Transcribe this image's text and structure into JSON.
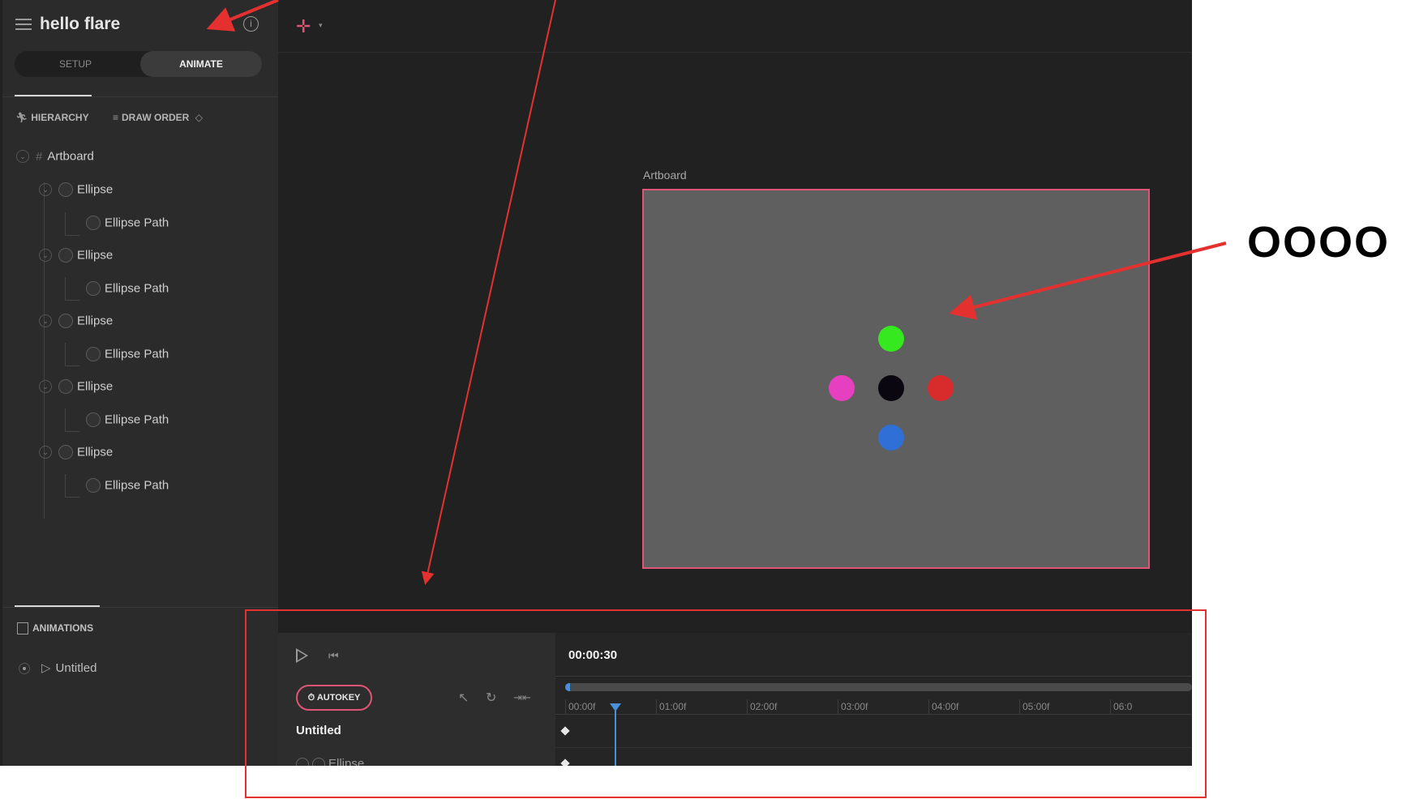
{
  "sidebar": {
    "title": "hello flare",
    "info_icon": "info-icon",
    "modes": {
      "setup": "SETUP",
      "animate": "ANIMATE",
      "active": "ANIMATE"
    },
    "tabs": {
      "hierarchy": "HIERARCHY",
      "draw_order": "DRAW ORDER"
    },
    "tree": [
      {
        "label": "Artboard",
        "type": "artboard"
      },
      {
        "label": "Ellipse",
        "type": "shape"
      },
      {
        "label": "Ellipse Path",
        "type": "path"
      },
      {
        "label": "Ellipse",
        "type": "shape"
      },
      {
        "label": "Ellipse Path",
        "type": "path"
      },
      {
        "label": "Ellipse",
        "type": "shape"
      },
      {
        "label": "Ellipse Path",
        "type": "path"
      },
      {
        "label": "Ellipse",
        "type": "shape"
      },
      {
        "label": "Ellipse Path",
        "type": "path"
      },
      {
        "label": "Ellipse",
        "type": "shape"
      },
      {
        "label": "Ellipse Path",
        "type": "path"
      }
    ],
    "animations": {
      "title": "ANIMATIONS",
      "items": [
        {
          "label": "Untitled"
        }
      ]
    }
  },
  "stage": {
    "artboard_label": "Artboard",
    "ellipses": [
      {
        "name": "green",
        "color": "#35e81f"
      },
      {
        "name": "pink",
        "color": "#e63fbf"
      },
      {
        "name": "black",
        "color": "#0b0711"
      },
      {
        "name": "red",
        "color": "#d82b2b"
      },
      {
        "name": "blue",
        "color": "#2f6fd6"
      }
    ],
    "accent_color": "#e05575"
  },
  "timeline": {
    "time": "00:00:30",
    "autokey_label": "AUTOKEY",
    "animation_name": "Untitled",
    "row_label": "Ellipse",
    "ticks": [
      "00:00f",
      "01:00f",
      "02:00f",
      "03:00f",
      "04:00f",
      "05:00f",
      "06:0"
    ]
  },
  "annotation": {
    "text": "OOOO",
    "color": "#e53030"
  }
}
